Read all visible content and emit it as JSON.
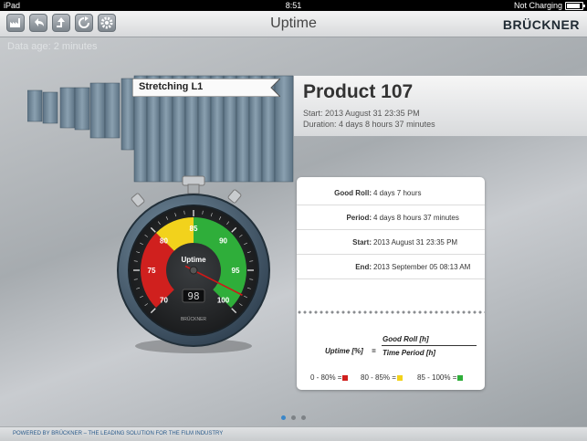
{
  "status_bar": {
    "device": "iPad",
    "time": "8:51",
    "battery": "Not Charging"
  },
  "nav": {
    "title": "Uptime",
    "brand": "BRÜCKNER"
  },
  "data_age": "Data age: 2 minutes",
  "section": "Stretching L1",
  "product": {
    "name": "Product 107",
    "start": "Start: 2013 August 31 23:35 PM",
    "duration": "Duration: 4 days 8 hours 37 minutes"
  },
  "gauge": {
    "label": "Uptime",
    "value": 98,
    "value_text": "98",
    "brand": "BRÜCKNER",
    "ticks": [
      "70",
      "75",
      "80",
      "85",
      "90",
      "95",
      "100"
    ]
  },
  "details": [
    {
      "label": "Good Roll:",
      "value": "4 days 7 hours"
    },
    {
      "label": "Period:",
      "value": "4 days 8 hours 37 minutes"
    },
    {
      "label": "Start:",
      "value": "2013 August 31 23:35 PM"
    },
    {
      "label": "End:",
      "value": "2013 September 05 08:13 AM"
    }
  ],
  "formula": {
    "lhs": "Uptime [%]",
    "eq": "=",
    "numerator": "Good Roll [h]",
    "denominator": "Time Period [h]"
  },
  "legend": [
    {
      "label": "0 - 80% =",
      "color": "#d0201e"
    },
    {
      "label": "80 - 85% =",
      "color": "#f2d21c"
    },
    {
      "label": "85 - 100% =",
      "color": "#2fae3a"
    }
  ],
  "pager": {
    "count": 3,
    "active": 0
  },
  "footer": "POWERED BY BRÜCKNER  –  THE LEADING SOLUTION FOR THE FILM INDUSTRY"
}
